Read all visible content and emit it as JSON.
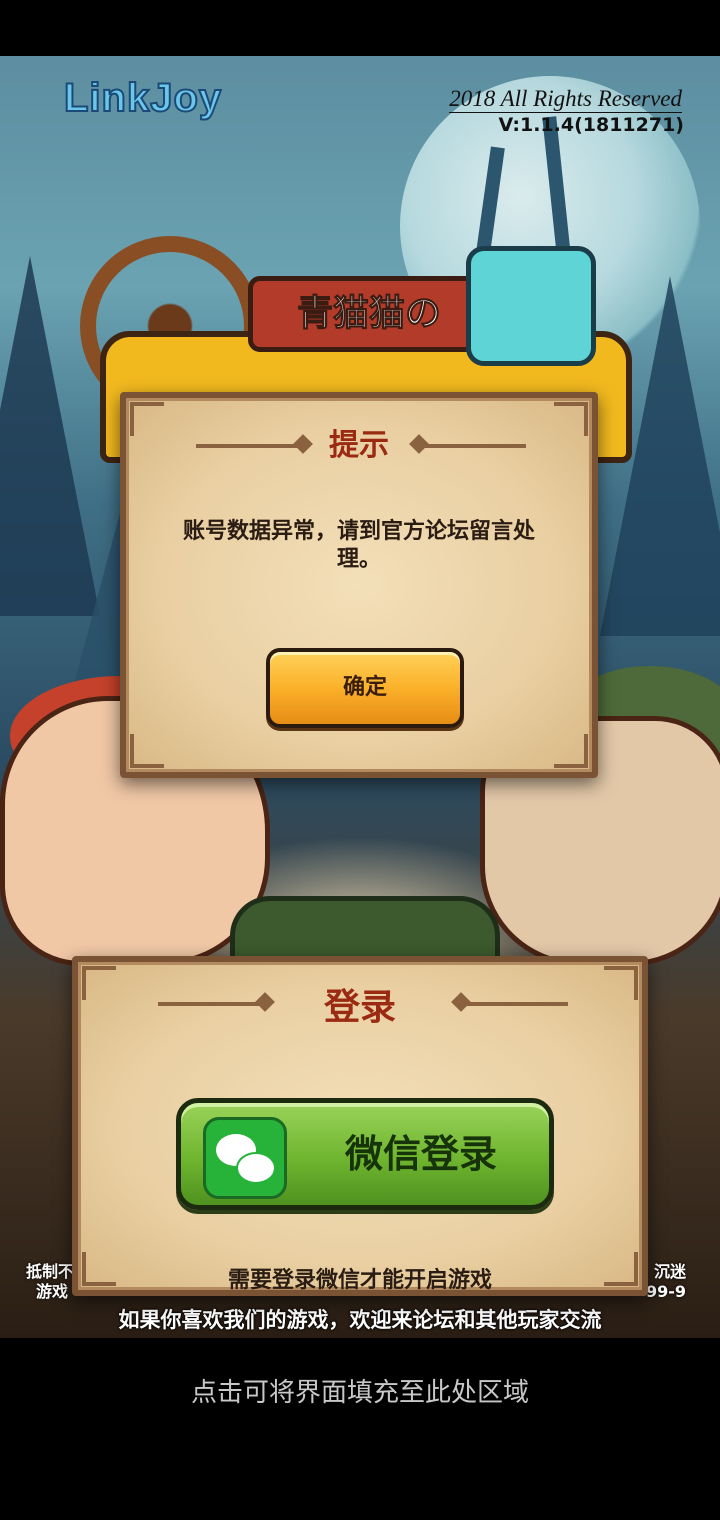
{
  "header": {
    "logo_text": "LinkJoy",
    "copyright": "2018 All Rights Reserved",
    "version": "V:1.1.4(1811271)"
  },
  "game_logo": {
    "subtitle": "青猫猫の"
  },
  "dialog": {
    "title": "提示",
    "message": "账号数据异常，请到官方论坛留言处理。",
    "confirm_label": "确定"
  },
  "login": {
    "title": "登录",
    "wechat_button_label": "微信登录",
    "note": "需要登录微信才能开启游戏"
  },
  "side_notes": {
    "left_line1": "抵制不",
    "left_line2": "游戏",
    "right_line1": "沉迷",
    "right_line2": "99-9"
  },
  "forum_text": "如果你喜欢我们的游戏，欢迎来论坛和其他玩家交流",
  "fill_hint": "点击可将界面填充至此处区域",
  "colors": {
    "title_red": "#9b2a12",
    "confirm_orange": "#fbb12a",
    "wechat_green": "#6fb52f"
  }
}
